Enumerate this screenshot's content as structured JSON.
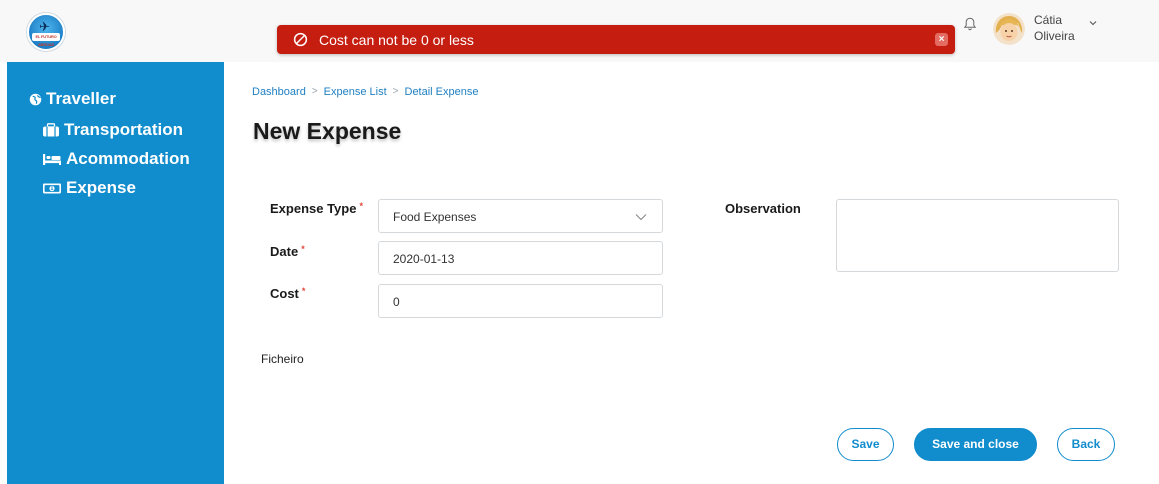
{
  "app": {
    "logo_text": "EL FUTURO ABROAD"
  },
  "alert": {
    "message": "Cost can not be 0 or less",
    "close_label": "×",
    "color": "#c51d10"
  },
  "user": {
    "first_name": "Cátia",
    "last_name": "Oliveira"
  },
  "sidebar": {
    "color": "#118ccc",
    "items": [
      {
        "label": "Traveller",
        "icon": "globe-icon"
      },
      {
        "label": "Transportation",
        "icon": "suitcase-icon"
      },
      {
        "label": "Acommodation",
        "icon": "bed-icon"
      },
      {
        "label": "Expense",
        "icon": "money-icon"
      }
    ]
  },
  "breadcrumb": [
    {
      "label": "Dashboard"
    },
    {
      "label": "Expense List"
    },
    {
      "label": "Detail Expense"
    }
  ],
  "page": {
    "title": "New Expense"
  },
  "form": {
    "expense_type": {
      "label": "Expense Type",
      "required_mark": "*",
      "value": "Food Expenses"
    },
    "date": {
      "label": "Date",
      "required_mark": "*",
      "value": "2020-01-13"
    },
    "cost": {
      "label": "Cost",
      "required_mark": "*",
      "value": "0"
    },
    "observation": {
      "label": "Observation",
      "value": ""
    },
    "file_label": "Ficheiro"
  },
  "actions": {
    "save": "Save",
    "save_close": "Save and close",
    "back": "Back"
  }
}
